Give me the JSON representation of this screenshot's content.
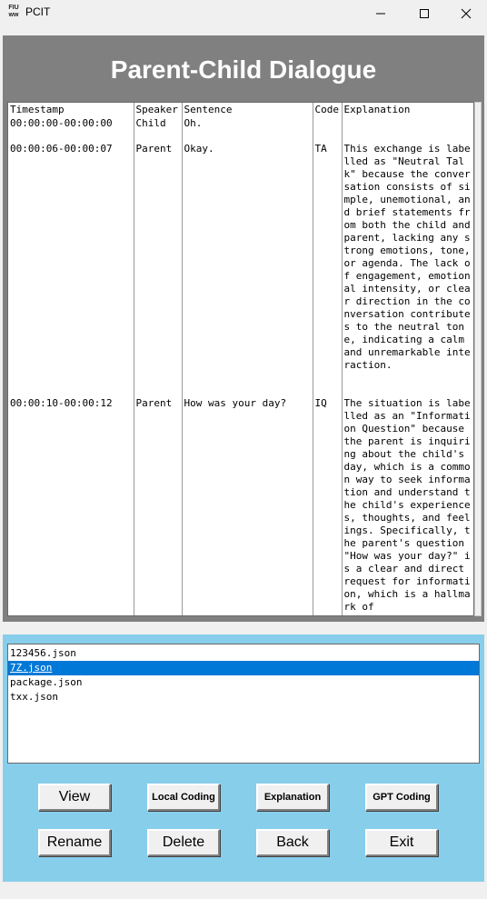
{
  "window": {
    "title": "PCIT",
    "icon_text": "FIU",
    "icon_subtext": "ww"
  },
  "header": {
    "title": "Parent-Child Dialogue"
  },
  "dialogue": {
    "columns": [
      "Timestamp",
      "Speaker",
      "Sentence",
      "Code",
      "Explanation"
    ],
    "rows": [
      {
        "timestamp": "00:00:00-00:00:00",
        "speaker": "Child",
        "sentence": "Oh.",
        "code": "",
        "explanation": ""
      },
      {
        "timestamp": "00:00:06-00:00:07",
        "speaker": "Parent",
        "sentence": "Okay.",
        "code": "TA",
        "explanation": "This exchange is labelled as \"Neutral Talk\" because the conversation consists of simple, unemotional, and brief statements from both the child and parent, lacking any strong emotions, tone, or agenda. The lack of engagement, emotional intensity, or clear direction in the conversation contributes to the neutral tone, indicating a calm and unremarkable interaction."
      },
      {
        "timestamp": "00:00:10-00:00:12",
        "speaker": "Parent",
        "sentence": "How was your day?",
        "code": "IQ",
        "explanation": "The situation is labelled as an \"Information Question\" because the parent is inquiring about the child's day, which is a common way to seek information and understand the child's experiences, thoughts, and feelings. Specifically, the parent's question \"How was your day?\" is a clear and direct request for information, which is a hallmark of"
      }
    ]
  },
  "files": {
    "items": [
      "123456.json",
      "7Z.json",
      "package.json",
      "txx.json"
    ],
    "selected_index": 1
  },
  "buttons": {
    "view": "View",
    "local_coding": "Local Coding",
    "explanation": "Explanation",
    "gpt_coding": "GPT Coding",
    "rename": "Rename",
    "delete": "Delete",
    "back": "Back",
    "exit": "Exit"
  },
  "colors": {
    "header_bg": "#808080",
    "bottom_bg": "#87ceeb",
    "selection": "#0078d7"
  }
}
